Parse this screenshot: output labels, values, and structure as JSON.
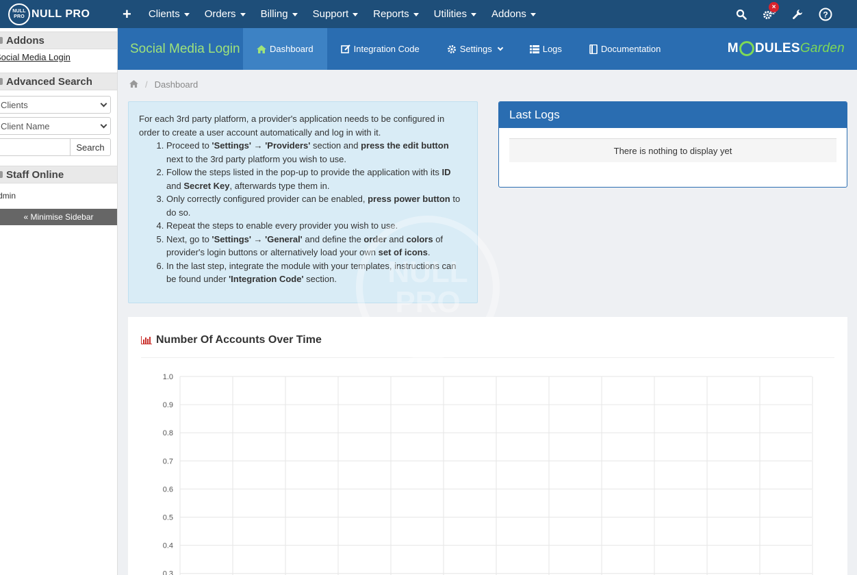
{
  "topbar": {
    "logo_top": "NULL",
    "logo_bottom": "PRO",
    "brand": "NULL PRO",
    "add_icon": "plus-icon",
    "menu": [
      "Clients",
      "Orders",
      "Billing",
      "Support",
      "Reports",
      "Utilities",
      "Addons"
    ],
    "icons": [
      "search-icon",
      "gears-icon",
      "wrench-icon",
      "help-icon"
    ],
    "alert_badge": "×"
  },
  "sidebar": {
    "addons_title": "Addons",
    "addons_link": "Social Media Login",
    "advanced_search_title": "Advanced Search",
    "search_type_value": "Clients",
    "search_field_value": "Client Name",
    "search_input_value": "",
    "search_button": "Search",
    "staff_online_title": "Staff Online",
    "staff_online_user": "Admin",
    "minimise_label": "« Minimise Sidebar"
  },
  "module": {
    "title": "Social Media Login",
    "tabs": [
      {
        "label": "Dashboard",
        "icon": "home-icon"
      },
      {
        "label": "Integration Code",
        "icon": "edit-icon"
      },
      {
        "label": "Settings",
        "icon": "gear-icon"
      },
      {
        "label": "Logs",
        "icon": "list-icon"
      },
      {
        "label": "Documentation",
        "icon": "book-icon"
      }
    ],
    "brand_part1": "M",
    "brand_part2": "DULES",
    "brand_part3": "Garden"
  },
  "breadcrumb": {
    "home_icon": "home-icon",
    "current": "Dashboard"
  },
  "info": {
    "intro": "For each 3rd party platform, a provider's application needs to be configured in order to create a user account automatically and log in with it.",
    "steps": [
      {
        "parts": [
          "Proceed to ",
          "'Settings' → 'Providers'",
          " section and ",
          "press the edit button",
          " next to the 3rd party platform you wish to use."
        ]
      },
      {
        "parts": [
          "Follow the steps listed in the pop-up to provide the application with its ",
          "ID",
          " and ",
          "Secret Key",
          ", afterwards type them in."
        ]
      },
      {
        "parts": [
          "Only correctly configured provider can be enabled, ",
          "press power button",
          " to do so."
        ]
      },
      {
        "parts": [
          "Repeat the steps to enable every provider you wish to use."
        ]
      },
      {
        "parts": [
          "Next, go to ",
          "'Settings' → 'General'",
          " and define the ",
          "order",
          " and ",
          "colors",
          " of provider's login buttons or alternatively load your own ",
          "set of icons",
          "."
        ]
      },
      {
        "parts": [
          "In the last step, integrate the module with your templates, instructions can be found under ",
          "'Integration Code'",
          " section."
        ]
      }
    ]
  },
  "logs": {
    "title": "Last Logs",
    "empty": "There is nothing to display yet"
  },
  "chart_data": {
    "type": "line",
    "title": "Number Of Accounts Over Time",
    "title_icon": "bar-chart-icon",
    "xlabel": "",
    "ylabel": "",
    "ylim": [
      0.3,
      1.0
    ],
    "y_ticks": [
      "1.0",
      "0.9",
      "0.8",
      "0.7",
      "0.6",
      "0.5",
      "0.4",
      "0.3"
    ],
    "x_gridlines": 12,
    "grid": true,
    "series": []
  },
  "watermark": {
    "line1": "NULL",
    "line2": "PRO"
  }
}
